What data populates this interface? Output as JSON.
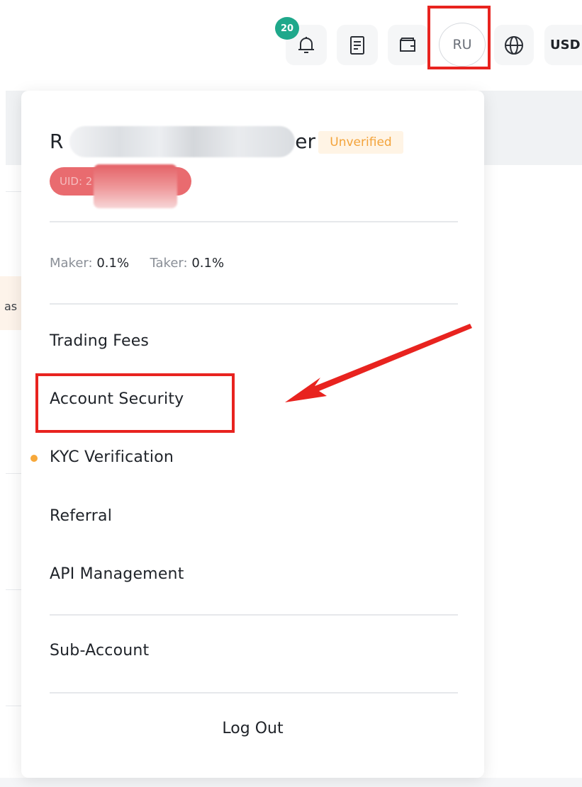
{
  "header": {
    "notification_count": "20",
    "avatar_initials": "RU",
    "currency_label": "USD"
  },
  "background": {
    "partial_text": "as"
  },
  "account_menu": {
    "username_start": "R",
    "username_end": "er",
    "verification_badge": "Unverified",
    "uid_label": "UID: 2",
    "fees": {
      "maker_label": "Maker:",
      "maker_value": "0.1%",
      "taker_label": "Taker:",
      "taker_value": "0.1%"
    },
    "items": [
      {
        "label": "Trading Fees"
      },
      {
        "label": "Account Security"
      },
      {
        "label": "KYC Verification"
      },
      {
        "label": "Referral"
      },
      {
        "label": "API Management"
      },
      {
        "label": "Sub-Account"
      }
    ],
    "logout_label": "Log Out"
  },
  "colors": {
    "accent_teal": "#1fa88b",
    "unverified_orange": "#f3a33a",
    "highlight_red": "#e8231f",
    "kyc_dot": "#f7a83a"
  },
  "annotations": {
    "highlight_targets": [
      "avatar",
      "Account Security"
    ],
    "arrow_target": "Account Security"
  }
}
